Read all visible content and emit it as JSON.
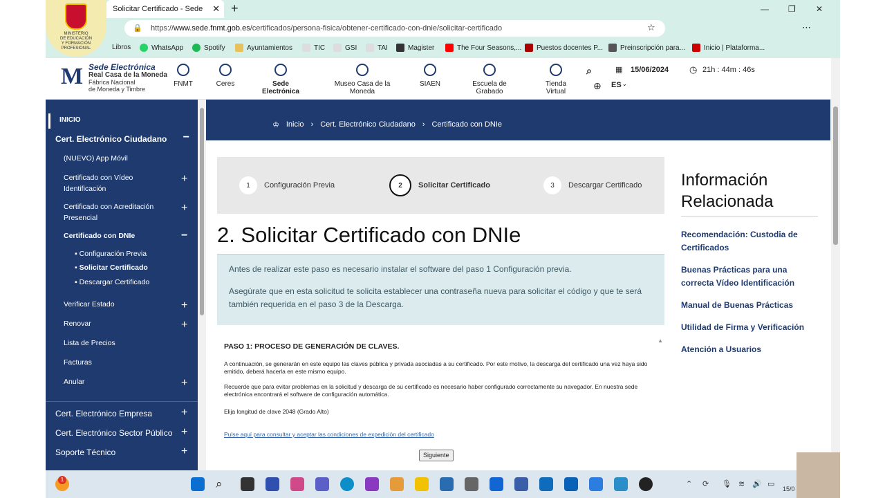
{
  "browser": {
    "tab_title": "Solicitar Certificado - Sede",
    "url_prefix": "https://",
    "url_domain": "www.sede.fnmt.gob.es",
    "url_path": "/certificados/persona-fisica/obtener-certificado-con-dnie/solicitar-certificado",
    "bookmarks": [
      "Libros",
      "WhatsApp",
      "Spotify",
      "Ayuntamientos",
      "TIC",
      "GSI",
      "TAI",
      "Magister",
      "The Four Seasons,...",
      "Puestos docentes P...",
      "Preinscripción para...",
      "Inicio | Plataforma..."
    ]
  },
  "ministry": {
    "l1": "MINISTERIO",
    "l2": "DE EDUCACIÓN",
    "l3": "Y FORMACIÓN",
    "l4": "PROFESIONAL"
  },
  "header": {
    "logo_t1": "Sede Electrónica",
    "logo_t2": "Real Casa de la Moneda",
    "logo_t3": "Fábrica Nacional",
    "logo_t4": "de Moneda y Timbre",
    "nav": [
      "FNMT",
      "Ceres",
      "Sede Electrónica",
      "Museo Casa de la Moneda",
      "SIAEN",
      "Escuela de Grabado",
      "Tienda Virtual"
    ],
    "date": "15/06/2024",
    "time": "21h : 44m : 46s",
    "lang": "ES"
  },
  "sidebar": {
    "inicio": "INICIO",
    "ciudadano": "Cert. Electrónico Ciudadano",
    "app": "(NUEVO) App Móvil",
    "video": "Certificado con Vídeo Identificación",
    "acred": "Certificado con Acreditación Presencial",
    "dnie": "Certificado con DNIe",
    "sub1": "Configuración Previa",
    "sub2": "Solicitar Certificado",
    "sub3": "Descargar Certificado",
    "verificar": "Verificar Estado",
    "renovar": "Renovar",
    "precios": "Lista de Precios",
    "facturas": "Facturas",
    "anular": "Anular",
    "empresa": "Cert. Electrónico Empresa",
    "publico": "Cert. Electrónico Sector Público",
    "soporte": "Soporte Técnico"
  },
  "breadcrumb": {
    "home": "Inicio",
    "c1": "Cert. Electrónico Ciudadano",
    "c2": "Certificado con DNIe"
  },
  "steps": [
    {
      "n": "1",
      "label": "Configuración Previa"
    },
    {
      "n": "2",
      "label": "Solicitar Certificado"
    },
    {
      "n": "3",
      "label": "Descargar Certificado"
    }
  ],
  "title": "2. Solicitar Certificado con DNIe",
  "info": {
    "p1": "Antes de realizar este paso es necesario instalar el software del paso 1 Configuración previa.",
    "p2": "Asegúrate que en esta solicitud te solicita establecer una contraseña nueva para solicitar el código y que te será también requerida en el paso 3 de la Descarga."
  },
  "form": {
    "title": "PASO 1: PROCESO DE GENERACIÓN DE CLAVES.",
    "p1": "A continuación, se generarán en este equipo las claves pública y privada asociadas a su certificado. Por este motivo, la descarga del certificado una vez haya sido emitido, deberá hacerla en este mismo equipo.",
    "p2": "Recuerde que para evitar problemas en la solicitud y descarga de su certificado es necesario haber configurado correctamente su navegador. En nuestra sede electrónica encontrará el software de configuración automática.",
    "p3": "Elija longitud de clave 2048  (Grado Alto)",
    "link": "Pulse aquí para consultar y aceptar las condiciones de expedición del certificado",
    "btn": "Siguiente"
  },
  "aside": {
    "title1": "Información",
    "title2": "Relacionada",
    "links": [
      "Recomendación: Custodia de Certificados",
      "Buenas Prácticas para una correcta Vídeo Identificación",
      "Manual de Buenas Prácticas",
      "Utilidad de Firma y Verificación",
      "Atención a Usuarios"
    ]
  },
  "taskbar": {
    "badge": "1",
    "date": "15/0"
  }
}
